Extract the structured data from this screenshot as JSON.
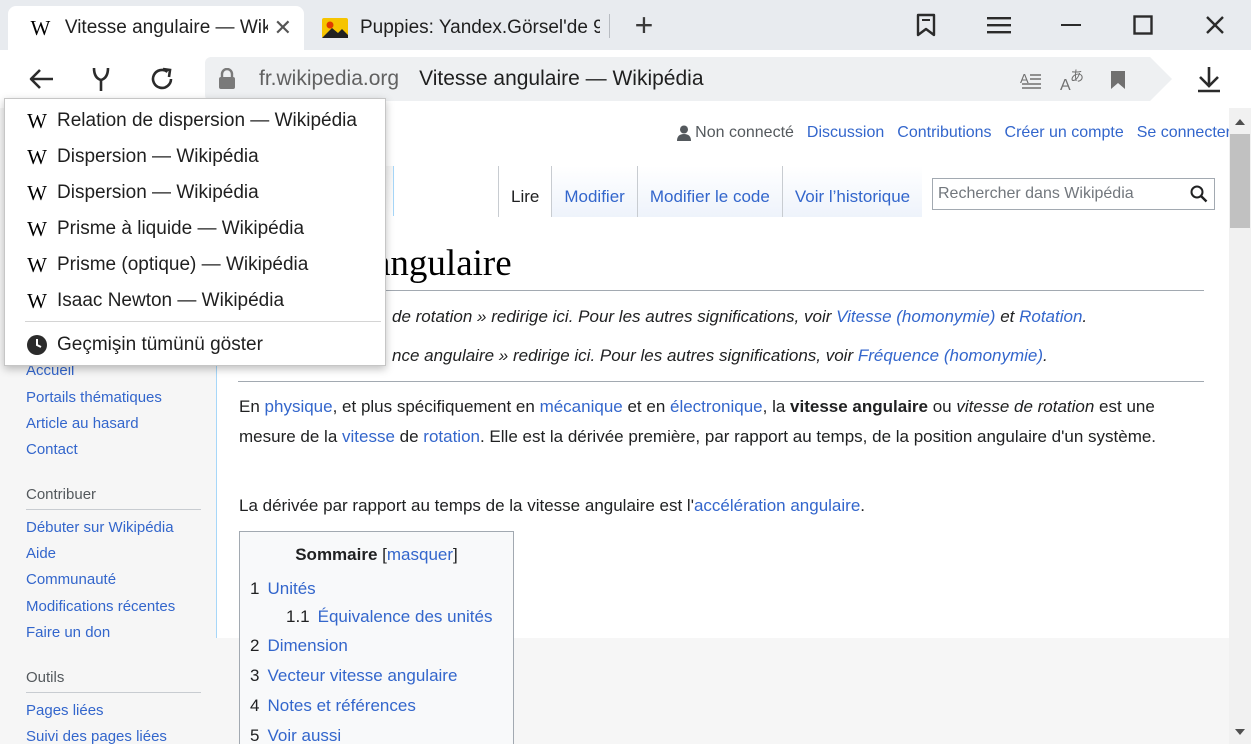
{
  "browser": {
    "tabs": [
      {
        "title": "Vitesse angulaire — Wikipédia",
        "display": "Vitesse angulaire — Wiki",
        "favicon": "W",
        "active": true
      },
      {
        "title": "Puppies: Yandex.Görsel'de 9",
        "display": "Puppies: Yandex.Görsel'de 9",
        "favicon": "yandex-images-icon",
        "active": false
      }
    ],
    "new_tab_symbol": "+",
    "address": {
      "domain": "fr.wikipedia.org",
      "page_title": "Vitesse angulaire — Wikipédia"
    }
  },
  "history_menu": {
    "items": [
      "Relation de dispersion — Wikipédia",
      "Dispersion — Wikipédia",
      "Dispersion — Wikipédia",
      "Prisme à liquide — Wikipédia",
      "Prisme (optique) — Wikipédia",
      "Isaac Newton — Wikipédia"
    ],
    "show_all": "Geçmişin tümünü göster"
  },
  "wiki": {
    "personal": {
      "not_logged": "Non connecté",
      "discussion": "Discussion",
      "contributions": "Contributions",
      "create_account": "Créer un compte",
      "login": "Se connecter"
    },
    "tabs": {
      "read": "Lire",
      "edit": "Modifier",
      "edit_code": "Modifier le code",
      "history": "Voir l’historique"
    },
    "search_placeholder": "Rechercher dans Wikipédia",
    "heading_visible": "angulaire",
    "hatnote1": {
      "pre": "de rotation » redirige ici. Pour les autres significations, voir ",
      "link1": "Vitesse (homonymie)",
      "mid": " et ",
      "link2": "Rotation",
      "post": "."
    },
    "hatnote2": {
      "pre": "nce angulaire » redirige ici. Pour les autres significations, voir ",
      "link1": "Fréquence (homonymie)",
      "post": "."
    },
    "para1": {
      "t1": "En ",
      "l1": "physique",
      "t2": ", et plus spécifiquement en ",
      "l2": "mécanique",
      "t3": " et en ",
      "l3": "électronique",
      "t4": ", la ",
      "b1": "vitesse angulaire",
      "t5": " ou ",
      "i1": "vitesse de rotation",
      "t6": " est une mesure de la ",
      "l4": "vitesse",
      "t7": " de ",
      "l5": "rotation",
      "t8": ". Elle est la dérivée première, par rapport au temps, de la position angulaire d'un système."
    },
    "para2": {
      "t1": "La dérivée par rapport au temps de la vitesse angulaire est l'",
      "l1": "accélération angulaire",
      "t2": "."
    },
    "toc": {
      "title": "Sommaire",
      "toggle_open": "[",
      "toggle": "masquer",
      "toggle_close": "]",
      "items": [
        {
          "num": "1",
          "label": "Unités"
        },
        {
          "num": "1.1",
          "label": "Équivalence des unités"
        },
        {
          "num": "2",
          "label": "Dimension"
        },
        {
          "num": "3",
          "label": "Vecteur vitesse angulaire"
        },
        {
          "num": "4",
          "label": "Notes et références"
        },
        {
          "num": "5",
          "label": "Voir aussi"
        }
      ]
    },
    "sidebar": {
      "nav": [
        "Accueil",
        "Portails thématiques",
        "Article au hasard",
        "Contact"
      ],
      "contribute_head": "Contribuer",
      "contribute": [
        "Débuter sur Wikipédia",
        "Aide",
        "Communauté",
        "Modifications récentes",
        "Faire un don"
      ],
      "tools_head": "Outils",
      "tools": [
        "Pages liées",
        "Suivi des pages liées"
      ]
    }
  }
}
